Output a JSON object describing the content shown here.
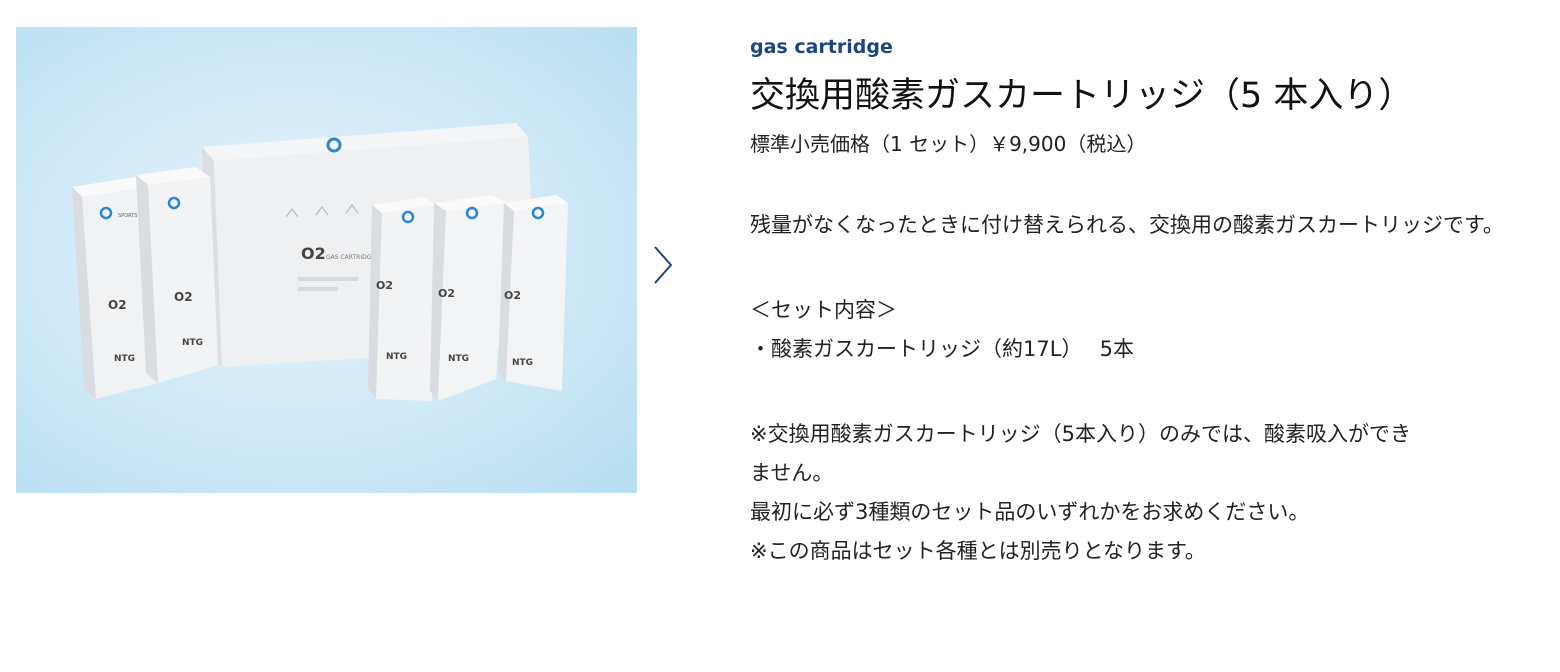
{
  "product": {
    "category": "gas cartridge",
    "title": "交換用酸素ガスカートリッジ（5 本入り）",
    "price": "標準小売価格（1 セット）￥9,900（税込）",
    "description": "残量がなくなったときに付け替えられる、交換用の酸素ガスカートリッジです。",
    "set_contents_heading": "＜セット内容＞",
    "set_contents_item": "・酸素ガスカートリッジ（約17L）　 5本",
    "notes": [
      "※交換用酸素ガスカートリッジ（5本入り）のみでは、酸素吸入ができ",
      "ません。",
      "最初に必ず3種類のセット品のいずれかをお求めください。",
      "※この商品はセット各種とは別売りとなります。"
    ]
  },
  "image": {
    "box_brand": "SPORTS SANSO",
    "box_label": "O2",
    "box_sublabel": "GAS CARTRIDGE",
    "logo_text": "NTG"
  },
  "carousel": {
    "next_icon": "chevron-right-icon"
  },
  "colors": {
    "accent": "#1d4680",
    "logo_blue": "#2a86d0",
    "background_blue": "#c9e6f6"
  }
}
